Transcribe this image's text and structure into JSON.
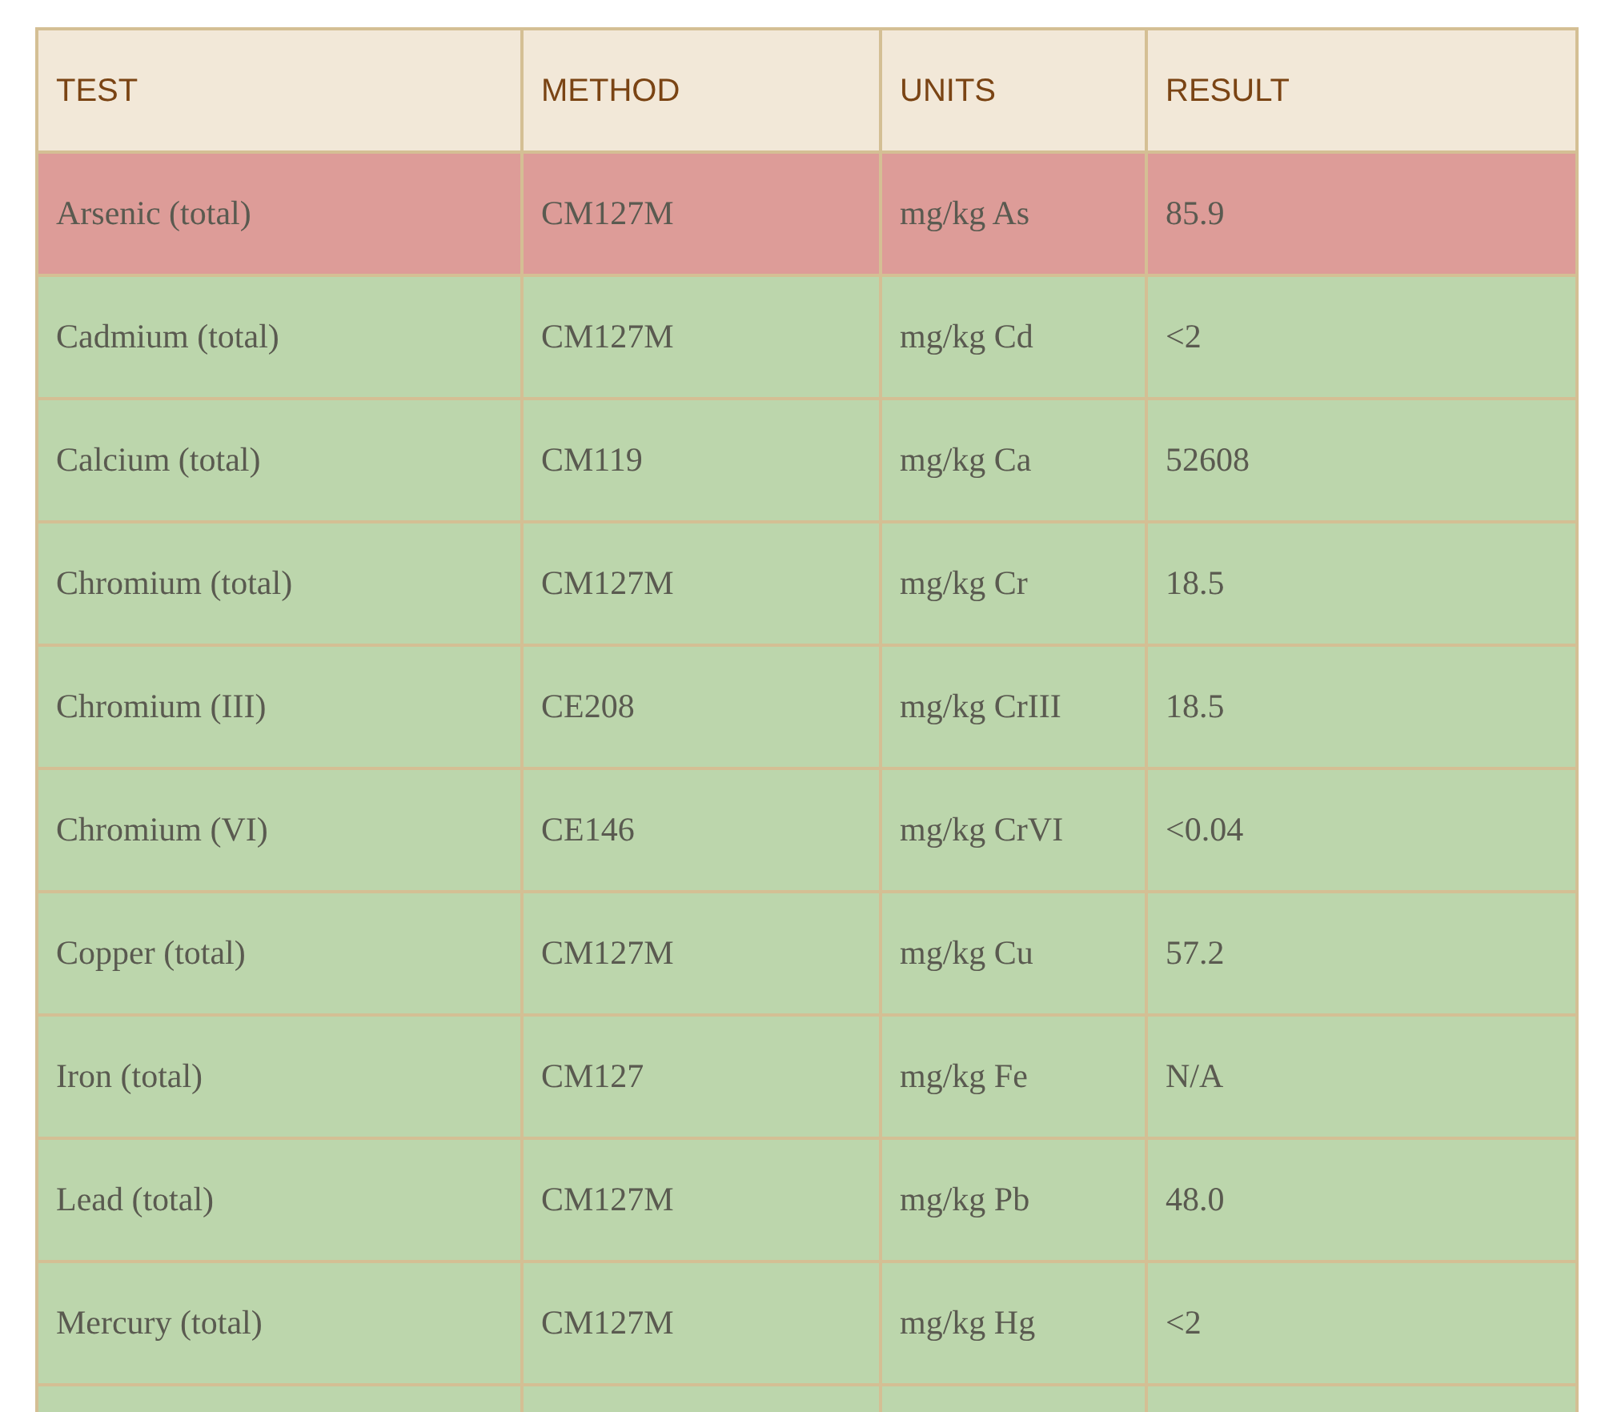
{
  "table": {
    "columns": [
      "TEST",
      "METHOD",
      "UNITS",
      "RESULT"
    ],
    "rows": [
      {
        "color": "#dd9c98",
        "cells": [
          "Arsenic (total)",
          "CM127M",
          "mg/kg As",
          "85.9"
        ]
      },
      {
        "color": "#bcd6ac",
        "cells": [
          "Cadmium (total)",
          "CM127M",
          "mg/kg Cd",
          "<2"
        ]
      },
      {
        "color": "#bcd6ac",
        "cells": [
          "Calcium (total)",
          "CM119",
          "mg/kg Ca",
          "52608"
        ]
      },
      {
        "color": "#bcd6ac",
        "cells": [
          "Chromium (total)",
          "CM127M",
          "mg/kg Cr",
          "18.5"
        ]
      },
      {
        "color": "#bcd6ac",
        "cells": [
          "Chromium (III)",
          "CE208",
          "mg/kg CrIII",
          "18.5"
        ]
      },
      {
        "color": "#bcd6ac",
        "cells": [
          "Chromium (VI)",
          "CE146",
          "mg/kg CrVI",
          "<0.04"
        ]
      },
      {
        "color": "#bcd6ac",
        "cells": [
          "Copper (total)",
          "CM127M",
          "mg/kg Cu",
          "57.2"
        ]
      },
      {
        "color": "#bcd6ac",
        "cells": [
          "Iron (total)",
          "CM127",
          "mg/kg Fe",
          "N/A"
        ]
      },
      {
        "color": "#bcd6ac",
        "cells": [
          "Lead (total)",
          "CM127M",
          "mg/kg Pb",
          "48.0"
        ]
      },
      {
        "color": "#bcd6ac",
        "cells": [
          "Mercury (total)",
          "CM127M",
          "mg/kg Hg",
          "<2"
        ]
      },
      {
        "color": "#bcd6ac"
      }
    ]
  }
}
